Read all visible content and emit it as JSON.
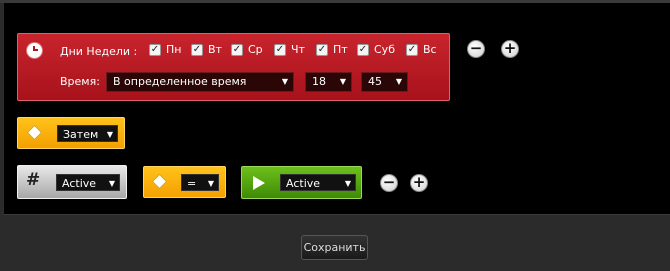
{
  "schedule": {
    "days_label": "Дни Недели :",
    "days": [
      "Пн",
      "Вт",
      "Ср",
      "Чт",
      "Пт",
      "Суб",
      "Вс"
    ],
    "checked": [
      true,
      true,
      true,
      true,
      true,
      true,
      true
    ],
    "time_label": "Время:",
    "time_mode": "В определенное время",
    "hour": "18",
    "minute": "45"
  },
  "then_block": {
    "value": "Затем"
  },
  "condition_row": {
    "variable_value": "Active",
    "operator_value": "=",
    "target_value": "Active"
  },
  "buttons": {
    "minus": "−",
    "plus": "+",
    "save": "Сохранить"
  },
  "colors": {
    "schedule_block": "#b81a23",
    "then_block": "#f7b000",
    "variable_block": "#c9c9c9",
    "operator_block": "#f7b000",
    "action_block": "#4ea10d"
  }
}
